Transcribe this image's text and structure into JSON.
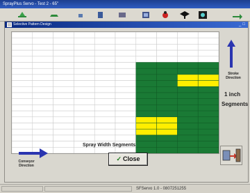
{
  "app": {
    "title": "SprayPlus Servo - Test 2 - 65\""
  },
  "toolbar": {
    "icons": [
      "tank-icon",
      "nozzle-icon",
      "pump-icon",
      "doc-icon",
      "settings-icon",
      "alarm-icon",
      "graduation-icon",
      "camera-icon",
      "exit-arrow-icon"
    ]
  },
  "dialog": {
    "title": "Selective Pattern Design",
    "stroke_direction_label": "Stroke Direction",
    "segment_size_label": "1 inch",
    "segments_label": "Segments",
    "conveyor_direction_label": "Conveyor Direction",
    "spray_width_label": "Spray Width Segments",
    "close_button_label": "Close"
  },
  "grid": {
    "rows": 20,
    "cols": 10,
    "colors": {
      "empty": "#ffffff",
      "on": "#1a7a35",
      "highlight": "#ffee00",
      "line": "#c8c8c8"
    },
    "green_start_col": 6,
    "green_start_row": 5,
    "yellow_blocks": [
      {
        "row_start": 7,
        "row_end": 8,
        "col_start": 8,
        "col_end": 9
      },
      {
        "row_start": 14,
        "row_end": 16,
        "col_start": 6,
        "col_end": 7
      }
    ]
  },
  "statusbar": {
    "text": "SFServo 1.0 - 0807251255"
  }
}
